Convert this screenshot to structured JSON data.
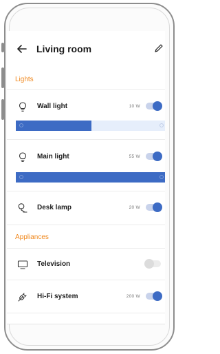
{
  "header": {
    "title": "Living room",
    "back_icon": "arrow-left-icon",
    "edit_icon": "pencil-icon"
  },
  "sections": {
    "lights": "Lights",
    "appliances": "Appliances"
  },
  "devices": {
    "wall_light": {
      "label": "Wall light",
      "power": "10 W",
      "on": true,
      "brightness": 0.5,
      "icon": "bulb-icon"
    },
    "main_light": {
      "label": "Main light",
      "power": "55 W",
      "on": true,
      "brightness": 1.0,
      "icon": "bulb-icon"
    },
    "desk_lamp": {
      "label": "Desk lamp",
      "power": "20 W",
      "on": true,
      "icon": "desk-lamp-icon"
    },
    "television": {
      "label": "Television",
      "power": "",
      "on": false,
      "icon": "tv-icon"
    },
    "hifi": {
      "label": "Hi-Fi system",
      "power": "200 W",
      "on": true,
      "icon": "plug-icon"
    }
  },
  "colors": {
    "accent": "#3d6bc4",
    "section_header": "#f08a21",
    "track": "#e6eefb"
  }
}
